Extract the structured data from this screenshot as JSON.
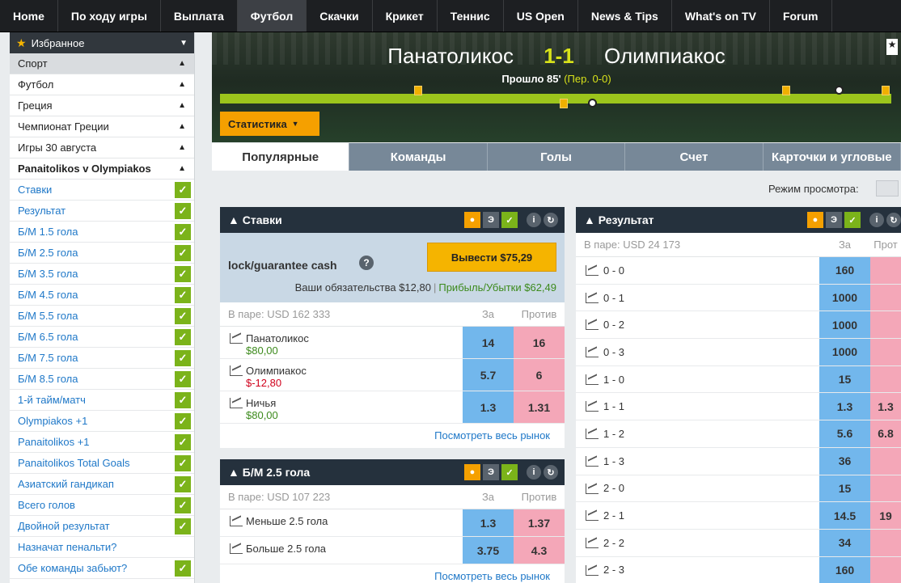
{
  "nav": [
    "Home",
    "По ходу игры",
    "Выплата",
    "Футбол",
    "Скачки",
    "Крикет",
    "Теннис",
    "US Open",
    "News & Tips",
    "What's on TV",
    "Forum"
  ],
  "nav_active": "Футбол",
  "sidebar": {
    "favorites": "Избранное",
    "crumbs": [
      "Спорт",
      "Футбол",
      "Греция",
      "Чемпионат Греции",
      "Игры 30 августа",
      "Panaitolikos v Olympiakos"
    ],
    "markets": [
      {
        "label": "Ставки",
        "checked": true
      },
      {
        "label": "Результат",
        "checked": true
      },
      {
        "label": "Б/М 1.5 гола",
        "checked": true
      },
      {
        "label": "Б/М 2.5 гола",
        "checked": true
      },
      {
        "label": "Б/М 3.5 гола",
        "checked": true
      },
      {
        "label": "Б/М 4.5 гола",
        "checked": true
      },
      {
        "label": "Б/М 5.5 гола",
        "checked": true
      },
      {
        "label": "Б/М 6.5 гола",
        "checked": true
      },
      {
        "label": "Б/М 7.5 гола",
        "checked": true
      },
      {
        "label": "Б/М 8.5 гола",
        "checked": true
      },
      {
        "label": "1-й тайм/матч",
        "checked": true
      },
      {
        "label": "Olympiakos +1",
        "checked": true
      },
      {
        "label": "Panaitolikos +1",
        "checked": true
      },
      {
        "label": "Panaitolikos Total Goals",
        "checked": true
      },
      {
        "label": "Азиатский гандикап",
        "checked": true
      },
      {
        "label": "Всего голов",
        "checked": true
      },
      {
        "label": "Двойной результат",
        "checked": true
      },
      {
        "label": "Назначат пенальти?",
        "checked": false
      },
      {
        "label": "Обе команды забьют?",
        "checked": true
      }
    ]
  },
  "match": {
    "home": "Панатоликос",
    "score": "1-1",
    "away": "Олимпиакос",
    "elapsed": "Прошло 85'",
    "halftime": "(Пер. 0-0)",
    "stats_button": "Статистика"
  },
  "tabs": [
    "Популярные",
    "Команды",
    "Голы",
    "Счет",
    "Карточки и угловые"
  ],
  "view_mode_label": "Режим просмотра:",
  "stavki": {
    "title": "Ставки",
    "cashout_label": "lock/guarantee cash",
    "cashout_button": "Вывести $75,29",
    "liability": "Ваши обязательства $12,80",
    "profit": "Прибыль/Убытки $62,49",
    "matched": "В паре: USD 162 333",
    "col_back": "За",
    "col_lay": "Против",
    "rows": [
      {
        "name": "Панатоликос",
        "pl": "$80,00",
        "pl_sign": "pos",
        "back": "14",
        "lay": "16"
      },
      {
        "name": "Олимпиакос",
        "pl": "$-12,80",
        "pl_sign": "neg",
        "back": "5.7",
        "lay": "6"
      },
      {
        "name": "Ничья",
        "pl": "$80,00",
        "pl_sign": "pos",
        "back": "1.3",
        "lay": "1.31"
      }
    ],
    "see_all": "Посмотреть весь рынок"
  },
  "goals25": {
    "title": "Б/М 2.5 гола",
    "matched": "В паре: USD 107 223",
    "col_back": "За",
    "col_lay": "Против",
    "rows": [
      {
        "name": "Меньше 2.5 гола",
        "back": "1.3",
        "lay": "1.37"
      },
      {
        "name": "Больше 2.5 гола",
        "back": "3.75",
        "lay": "4.3"
      }
    ],
    "see_all": "Посмотреть весь рынок"
  },
  "result": {
    "title": "Результат",
    "matched": "В паре: USD 24 173",
    "col_back": "За",
    "col_lay": "Прот",
    "rows": [
      {
        "name": "0 - 0",
        "back": "160",
        "lay": ""
      },
      {
        "name": "0 - 1",
        "back": "1000",
        "lay": ""
      },
      {
        "name": "0 - 2",
        "back": "1000",
        "lay": ""
      },
      {
        "name": "0 - 3",
        "back": "1000",
        "lay": ""
      },
      {
        "name": "1 - 0",
        "back": "15",
        "lay": ""
      },
      {
        "name": "1 - 1",
        "back": "1.3",
        "lay": "1.3"
      },
      {
        "name": "1 - 2",
        "back": "5.6",
        "lay": "6.8"
      },
      {
        "name": "1 - 3",
        "back": "36",
        "lay": ""
      },
      {
        "name": "2 - 0",
        "back": "15",
        "lay": ""
      },
      {
        "name": "2 - 1",
        "back": "14.5",
        "lay": "19"
      },
      {
        "name": "2 - 2",
        "back": "34",
        "lay": ""
      },
      {
        "name": "2 - 3",
        "back": "160",
        "lay": ""
      }
    ]
  },
  "colors": {
    "back": "#72b7ec",
    "lay": "#f4a7b8",
    "accent": "#f5a000",
    "check": "#7bb31a",
    "header": "#25313d"
  }
}
